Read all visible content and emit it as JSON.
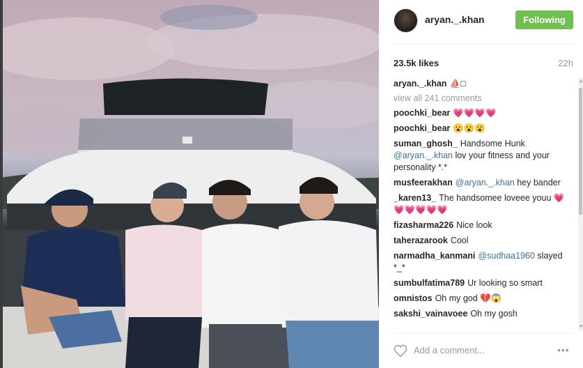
{
  "post": {
    "username": "aryan._.khan",
    "follow_button": "Following",
    "likes": "23.5k likes",
    "time": "22h",
    "caption": {
      "user": "aryan._.khan",
      "text": "⛵□"
    },
    "view_all": "view all 241 comments",
    "comments": [
      {
        "user": "poochki_bear",
        "text": "💗💗💗💗",
        "mention": "",
        "rest": ""
      },
      {
        "user": "poochki_bear",
        "text": "😮😮😮",
        "mention": "",
        "rest": ""
      },
      {
        "user": "suman_ghosh_",
        "text": "Handsome Hunk ",
        "mention": "@aryan._.khan",
        "rest": " lov your fitness and your personality *.*"
      },
      {
        "user": "musfeerakhan",
        "text": "",
        "mention": "@aryan._.khan",
        "rest": " hey bander"
      },
      {
        "user": "_karen13_",
        "text": "The handsomee loveee youu 💗💗💗💗💗💗",
        "mention": "",
        "rest": ""
      },
      {
        "user": "fizasharma226",
        "text": "Nice look",
        "mention": "",
        "rest": ""
      },
      {
        "user": "taherazarook",
        "text": "Cool",
        "mention": "",
        "rest": ""
      },
      {
        "user": "narmadha_kanmani",
        "text": "",
        "mention": "@sudhaa1960",
        "rest": " slayed *_*"
      },
      {
        "user": "sumbulfatima789",
        "text": "Ur looking so smart",
        "mention": "",
        "rest": ""
      },
      {
        "user": "omnistos",
        "text": "Oh my god 💔😱",
        "mention": "",
        "rest": ""
      },
      {
        "user": "sakshi_vainavoee",
        "text": "Oh my gosh",
        "mention": "",
        "rest": ""
      }
    ],
    "add_comment_placeholder": "Add a comment...",
    "more_icon": "•••"
  },
  "colors": {
    "follow_green": "#70c050",
    "mention_blue": "#3f729b",
    "muted": "#999999"
  },
  "icons": [
    "avatar",
    "heart-icon",
    "more-options-icon"
  ]
}
